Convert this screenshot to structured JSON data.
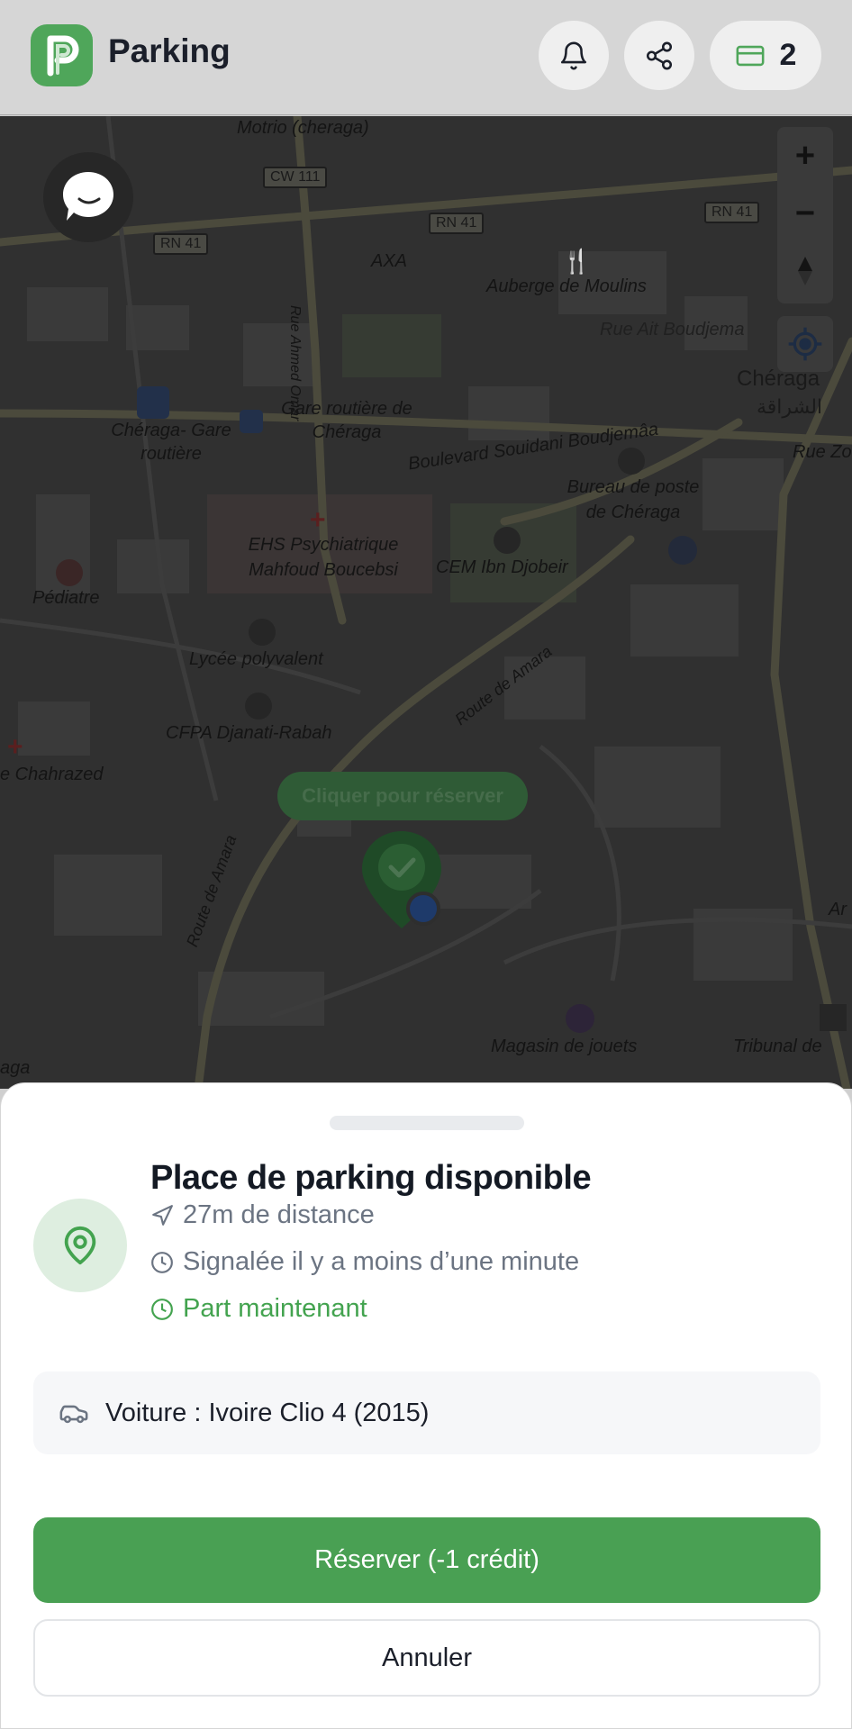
{
  "app": {
    "title": "Parking",
    "logo_letter": "P",
    "credits": "2"
  },
  "colors": {
    "brand_green": "#4fa65a",
    "reserve_green": "#49a053",
    "status_green": "#43a34f"
  },
  "icons": {
    "notifications": "bell-icon",
    "share": "share-icon",
    "credits": "card-icon",
    "chat": "chat-bubble-icon",
    "zoom_in": "plus-icon",
    "zoom_out": "minus-icon",
    "compass": "compass-icon",
    "locate": "locate-icon",
    "place": "map-pin-icon",
    "distance": "navigation-arrow-icon",
    "time": "clock-icon",
    "vehicle": "car-icon"
  },
  "map": {
    "tooltip": "Cliquer pour réserver",
    "labels": {
      "motrio": "Motrio (cheraga)",
      "axa": "AXA",
      "auberge": "Auberge de Moulins",
      "rue_ait": "Rue Ait Boudjema",
      "cheraga": "Chéraga",
      "cheraga_ar": "الشراقة",
      "gare_routiere": "Gare routière de Chéraga",
      "cheraga_gare": "Chéraga- Gare routière",
      "bd_souidani": "Boulevard Souidani Boudjemâa",
      "bureau_poste": "Bureau de poste de Chéraga",
      "ehs": "EHS Psychiatrique Mahfoud Boucebsi",
      "cem": "CEM Ibn Djobeir",
      "pediatre": "Pédiatre",
      "lycee": "Lycée polyvalent",
      "cfpa": "CFPA Djanati-Rabah",
      "chahrazed": "e Chahrazed",
      "route_amara": "Route de Amara",
      "route_amara2": "Route de Amara",
      "magasin": "Magasin de jouets",
      "tribunal": "Tribunal de",
      "rue_ahmed": "Rue Ahmed Omar",
      "rue_zo": "Rue Zo",
      "aga": "aga",
      "ar": "Ar"
    },
    "road_signs": {
      "cw111": "CW 111",
      "rn41_a": "RN 41",
      "rn41_b": "RN 41",
      "rn41_c": "RN 41"
    }
  },
  "place": {
    "title": "Place de parking disponible",
    "distance": "27m de distance",
    "reported": "Signalée il y a moins d’une minute",
    "leaving": "Part maintenant"
  },
  "vehicle": {
    "label": "Voiture : Ivoire Clio 4 (2015)"
  },
  "actions": {
    "reserve": "Réserver (-1 crédit)",
    "cancel": "Annuler"
  }
}
